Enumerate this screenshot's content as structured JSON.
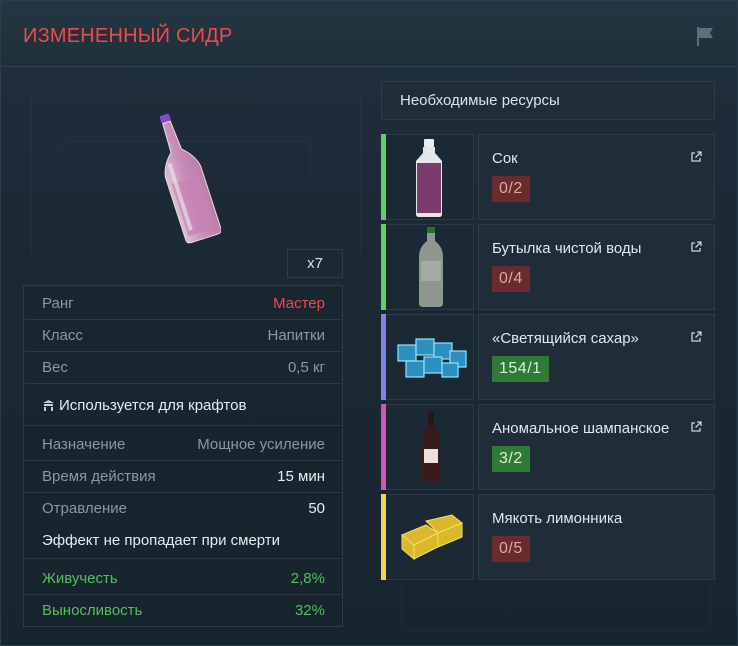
{
  "title": "ИЗМЕНЕННЫЙ СИДР",
  "icons": {
    "flag": "flag-icon",
    "crafting": "crafting-icon",
    "link": "external-link-icon"
  },
  "colors": {
    "title": "#f0484e",
    "positive": "#4fc15a",
    "deficit_badge": "#6a2a2e",
    "sufficient_badge": "#2f7a35"
  },
  "item": {
    "quantity": "x7",
    "rank_label": "Ранг",
    "rank_value": "Мастер",
    "class_label": "Класс",
    "class_value": "Напитки",
    "weight_label": "Вес",
    "weight_value": "0,5 кг",
    "crafting_note": "Используется для крафтов",
    "purpose_label": "Назначение",
    "purpose_value": "Мощное усиление",
    "duration_label": "Время действия",
    "duration_value": "15 мин",
    "poison_label": "Отравление",
    "poison_value": "50",
    "death_note": "Эффект не пропадает при смерти",
    "vitality_label": "Живучесть",
    "vitality_value": "2,8%",
    "stamina_label": "Выносливость",
    "stamina_value": "32%"
  },
  "resources": {
    "header": "Необходимые ресурсы",
    "items": [
      {
        "name": "Сок",
        "count": "0/2",
        "bar_color": "#5fd16a",
        "status": "insufficient"
      },
      {
        "name": "Бутылка чистой воды",
        "count": "0/4",
        "bar_color": "#5fd16a",
        "status": "insufficient"
      },
      {
        "name": "«Светящийся сахар»",
        "count": "154/1",
        "bar_color": "#7c84e6",
        "status": "sufficient"
      },
      {
        "name": "Аномальное шампанское",
        "count": "3/2",
        "bar_color": "#d94fc0",
        "status": "sufficient"
      },
      {
        "name": "Мякоть лимонника",
        "count": "0/5",
        "bar_color": "#f1d25a",
        "status": "insufficient"
      }
    ]
  }
}
